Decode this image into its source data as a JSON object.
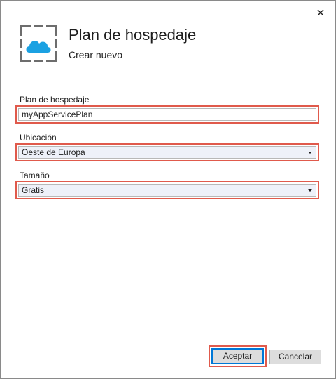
{
  "window": {
    "close_icon": "close-icon"
  },
  "header": {
    "icon": "app-service-plan-icon",
    "title": "Plan de hospedaje",
    "subtitle": "Crear nuevo"
  },
  "form": {
    "plan": {
      "label": "Plan de hospedaje",
      "value": "myAppServicePlan"
    },
    "location": {
      "label": "Ubicación",
      "selected": "Oeste de Europa"
    },
    "size": {
      "label": "Tamaño",
      "selected": "Gratis"
    }
  },
  "buttons": {
    "accept": "Aceptar",
    "cancel": "Cancelar"
  },
  "colors": {
    "highlight": "#e05a4c",
    "cloud": "#1ba1e2",
    "frame": "#6d6d6d",
    "primary_border": "#0078d7",
    "select_bg": "#eef1f9"
  }
}
